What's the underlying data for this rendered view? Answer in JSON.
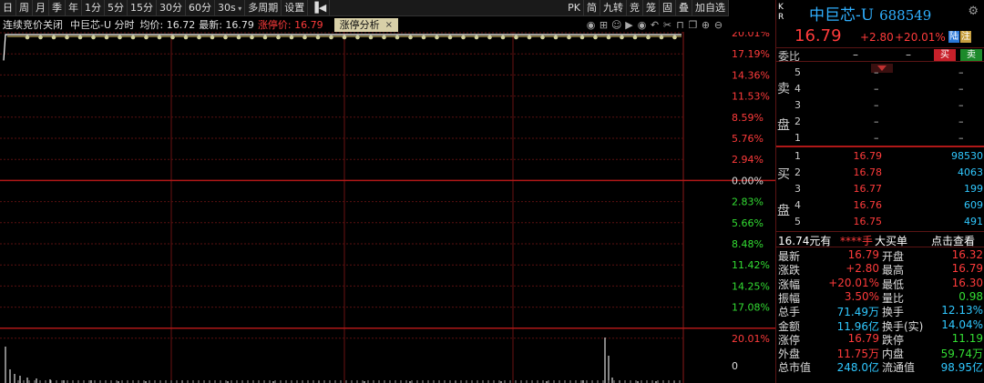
{
  "toolbar": {
    "left": [
      "日",
      "周",
      "月",
      "季",
      "年",
      "1分",
      "5分",
      "15分",
      "30分",
      "60分",
      "30s",
      "多周期",
      "设置"
    ],
    "right": [
      "PK",
      "简",
      "九转",
      "竞",
      "笼",
      "固",
      "叠",
      "加自选"
    ]
  },
  "infobar": {
    "status": "连续竞价关闭",
    "name": "中巨芯-U 分时",
    "avg": "均价: 16.72",
    "last": "最新: 16.79",
    "limit": "涨停价: 16.79",
    "tab": "涨停分析",
    "tab_close": "×"
  },
  "chart": {
    "upper_labels": [
      "20.01%",
      "17.19%",
      "14.36%",
      "11.53%",
      "8.59%",
      "5.76%",
      "2.94%",
      "0.00%",
      "2.83%",
      "5.66%",
      "8.48%",
      "11.42%",
      "14.25%",
      "17.08%"
    ],
    "volume_labels": [
      "20.01%",
      "0"
    ]
  },
  "chart_data": {
    "type": "line",
    "series": [
      {
        "values": [
          16.3,
          16.79,
          16.79,
          16.79,
          16.79,
          16.79,
          16.79
        ]
      }
    ]
  },
  "panel": {
    "kr": [
      "K",
      "R"
    ],
    "title": "中巨芯-U",
    "code": "688549",
    "price": "16.79",
    "change": "+2.80",
    "pct": "+20.01%",
    "badge_lu": "陆",
    "badge_zhu": "注",
    "weibi_label": "委比",
    "weibi_v1": "–",
    "weibi_v2": "–",
    "buy_btn": "买",
    "sell_btn": "卖",
    "sell_side": "卖盘",
    "buy_side": "买盘",
    "sell_levels": [
      "5",
      "4",
      "3",
      "2",
      "1"
    ],
    "sell_dash": "–",
    "buy_rows": [
      {
        "lv": "1",
        "price": "16.79",
        "vol": "98530"
      },
      {
        "lv": "2",
        "price": "16.78",
        "vol": "4063"
      },
      {
        "lv": "3",
        "price": "16.77",
        "vol": "199"
      },
      {
        "lv": "4",
        "price": "16.76",
        "vol": "609"
      },
      {
        "lv": "5",
        "price": "16.75",
        "vol": "491"
      }
    ],
    "big": {
      "a": "16.74元有",
      "b": "****手",
      "c": "大买单",
      "d": "点击查看"
    },
    "stats": [
      {
        "l1": "最新",
        "v1": "16.79",
        "c1": "red",
        "l2": "开盘",
        "v2": "16.32",
        "c2": "red"
      },
      {
        "l1": "涨跌",
        "v1": "+2.80",
        "c1": "red",
        "l2": "最高",
        "v2": "16.79",
        "c2": "red"
      },
      {
        "l1": "涨幅",
        "v1": "+20.01%",
        "c1": "red",
        "l2": "最低",
        "v2": "16.30",
        "c2": "red"
      },
      {
        "l1": "振幅",
        "v1": "3.50%",
        "c1": "red",
        "l2": "量比",
        "v2": "0.98",
        "c2": "green"
      },
      {
        "l1": "总手",
        "v1": "71.49万",
        "c1": "cyan",
        "l2": "换手",
        "v2": "12.13%",
        "c2": "cyan"
      },
      {
        "l1": "金额",
        "v1": "11.96亿",
        "c1": "cyan",
        "l2": "换手(实)",
        "v2": "14.04%",
        "c2": "cyan"
      },
      {
        "l1": "涨停",
        "v1": "16.79",
        "c1": "red",
        "l2": "跌停",
        "v2": "11.19",
        "c2": "green"
      },
      {
        "l1": "外盘",
        "v1": "11.75万",
        "c1": "red",
        "l2": "内盘",
        "v2": "59.74万",
        "c2": "green"
      },
      {
        "l1": "总市值",
        "v1": "248.0亿",
        "c1": "cyan",
        "l2": "流通值",
        "v2": "98.95亿",
        "c2": "cyan"
      }
    ]
  }
}
